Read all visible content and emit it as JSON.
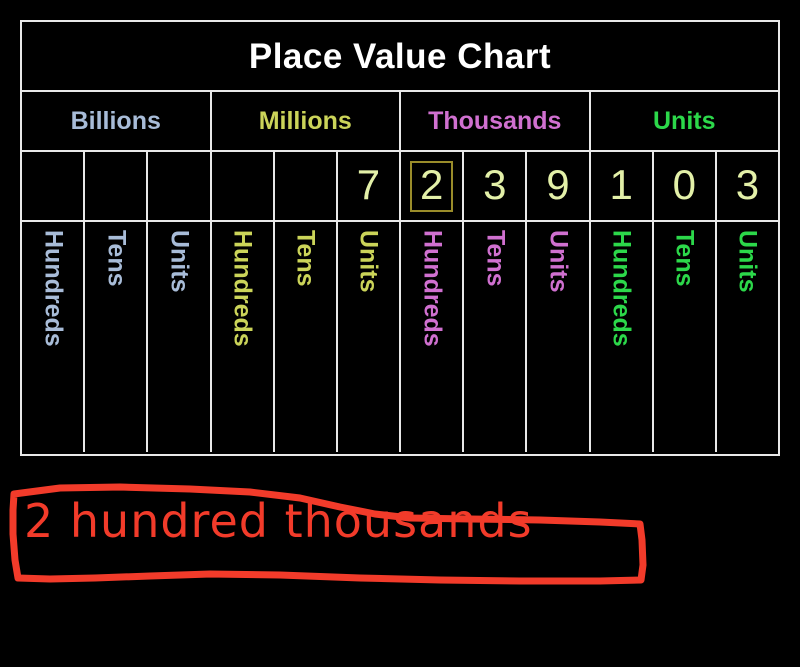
{
  "chart": {
    "title": "Place Value Chart",
    "title_color": "#ffffff",
    "border_color": "#e8e8e8",
    "background": "#000000",
    "groups": [
      {
        "label": "Billions",
        "color": "#a8bcd8"
      },
      {
        "label": "Millions",
        "color": "#cbd459"
      },
      {
        "label": "Thousands",
        "color": "#d070d0"
      },
      {
        "label": "Units",
        "color": "#2cd84a"
      }
    ],
    "columns": [
      {
        "group": "Billions",
        "place": "Hundreds",
        "digit": "",
        "color": "#a8bcd8",
        "highlighted": false
      },
      {
        "group": "Billions",
        "place": "Tens",
        "digit": "",
        "color": "#a8bcd8",
        "highlighted": false
      },
      {
        "group": "Billions",
        "place": "Units",
        "digit": "",
        "color": "#a8bcd8",
        "highlighted": false
      },
      {
        "group": "Millions",
        "place": "Hundreds",
        "digit": "",
        "color": "#cbd459",
        "highlighted": false
      },
      {
        "group": "Millions",
        "place": "Tens",
        "digit": "",
        "color": "#cbd459",
        "highlighted": false
      },
      {
        "group": "Millions",
        "place": "Units",
        "digit": "7",
        "color": "#cbd459",
        "highlighted": false
      },
      {
        "group": "Thousands",
        "place": "Hundreds",
        "digit": "2",
        "color": "#d070d0",
        "highlighted": true
      },
      {
        "group": "Thousands",
        "place": "Tens",
        "digit": "3",
        "color": "#d070d0",
        "highlighted": false
      },
      {
        "group": "Thousands",
        "place": "Units",
        "digit": "9",
        "color": "#d070d0",
        "highlighted": false
      },
      {
        "group": "Units",
        "place": "Hundreds",
        "digit": "1",
        "color": "#2cd84a",
        "highlighted": false
      },
      {
        "group": "Units",
        "place": "Tens",
        "digit": "0",
        "color": "#2cd84a",
        "highlighted": false
      },
      {
        "group": "Units",
        "place": "Units",
        "digit": "3",
        "color": "#2cd84a",
        "highlighted": false
      }
    ],
    "digit_color": "#e3f0a8",
    "highlight_color": "#9a8c2a"
  },
  "annotation": {
    "text": "2 hundred thousands",
    "color": "#f23b2a"
  }
}
